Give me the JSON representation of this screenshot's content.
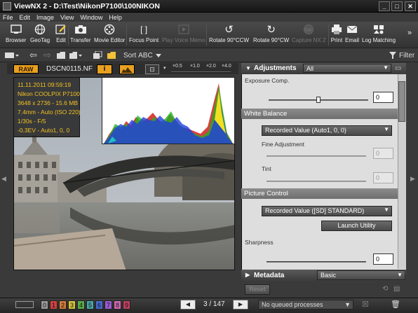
{
  "window": {
    "title": "ViewNX 2 - D:\\Test\\NikonP7100\\100NIKON",
    "minimize": "_",
    "maximize": "□",
    "close": "✕"
  },
  "menu": [
    "File",
    "Edit",
    "Image",
    "View",
    "Window",
    "Help"
  ],
  "toolbar": {
    "browser": "Browser",
    "geotag": "GeoTag",
    "edit": "Edit",
    "transfer": "Transfer",
    "movie_editor": "Movie Editor",
    "focus_point": "Focus Point",
    "play_voice_memo": "Play Voice Memo",
    "rotate_ccw": "Rotate 90°CCW",
    "rotate_cw": "Rotate 90°CW",
    "capture_nx2": "Capture NX 2",
    "print": "Print",
    "email": "Email",
    "log_matching": "Log Matching",
    "more": "»"
  },
  "toolbar2": {
    "sort_label": "Sort",
    "sort_value": "ABC",
    "filter": "Filter"
  },
  "viewer": {
    "raw_badge": "RAW",
    "filename": "DSCN0115.NF",
    "info_button": "i",
    "zoom_labels": [
      "×0.5",
      "×1.0",
      "×2.0",
      "×4.0"
    ],
    "info": [
      "11.11.2011 09:59:19",
      "Nikon COOLPIX P7100",
      "3648 x 2736 - 15.6 MB",
      "7.4mm - Auto (ISO 220)",
      "1/30s - F/5",
      "-0.3EV - Auto1, 0, 0"
    ]
  },
  "panel": {
    "header": "Adjustments",
    "header_select": "All",
    "exposure_label": "Exposure Comp.",
    "exposure_value": "0",
    "exposure_level": 0.5,
    "white_balance_header": "White Balance",
    "wb_select": "Recorded Value (Auto1, 0, 0)",
    "fine_adjustment_label": "Fine Adjustment",
    "fine_value": "0",
    "tint_label": "Tint",
    "tint_value": "0",
    "picture_control_header": "Picture Control",
    "pc_select": "Recorded Value ([SD] STANDARD)",
    "launch_utility": "Launch Utility",
    "sharpness_label": "Sharpness",
    "sharpness_value": "0",
    "metadata_header": "Metadata",
    "metadata_select": "Basic",
    "reset": "Reset"
  },
  "status": {
    "labels": [
      "0",
      "1",
      "2",
      "3",
      "4",
      "5",
      "6",
      "7",
      "8",
      "9"
    ],
    "label_colors": [
      "#9a9a9a",
      "#d14040",
      "#d07a3a",
      "#d4c23a",
      "#5caa4a",
      "#48a8a8",
      "#4a6ad0",
      "#9a5ad0",
      "#d06ab0",
      "#c04060"
    ],
    "page": "3 / 147",
    "queue": "No queued processes",
    "prev": "◀",
    "next": "▶"
  },
  "colors": {
    "accent_orange": "#e9a020",
    "info_text": "#f3c224"
  }
}
